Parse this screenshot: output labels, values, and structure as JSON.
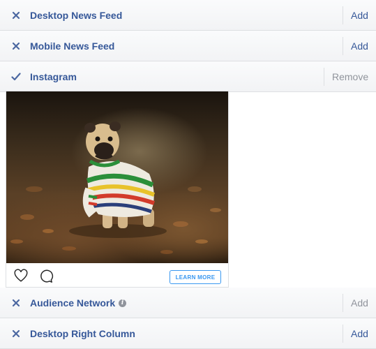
{
  "placements": [
    {
      "label": "Desktop News Feed",
      "status": "x",
      "action": "Add"
    },
    {
      "label": "Mobile News Feed",
      "status": "x",
      "action": "Add"
    },
    {
      "label": "Instagram",
      "status": "check",
      "action": "Remove"
    },
    {
      "label": "Audience Network",
      "status": "x",
      "action": "Add",
      "info": "i"
    },
    {
      "label": "Desktop Right Column",
      "status": "x",
      "action": "Add"
    }
  ],
  "preview": {
    "cta_label": "LEARN MORE",
    "icons": [
      "heart-icon",
      "comment-icon"
    ]
  },
  "colors": {
    "link": "#365899",
    "muted": "#90949c",
    "instagram_blue": "#3897f0",
    "border": "#dddfe2"
  }
}
